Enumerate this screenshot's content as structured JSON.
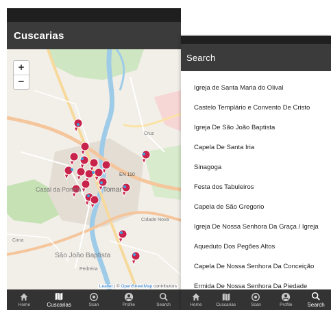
{
  "map_screen": {
    "title": "Cuscarias",
    "zoom_in": "+",
    "zoom_out": "−",
    "place_labels": [
      "Tomar",
      "São João Baptista",
      "Pedreira",
      "EN 110",
      "Cima",
      "Cruz",
      "Casal da Portela",
      "Cidade Nova"
    ],
    "attribution": {
      "leaflet": "Leaflet",
      "separator": " | © ",
      "osm": "OpenStreetMap",
      "contributors": " contributors"
    }
  },
  "search_screen": {
    "title": "Search",
    "results": [
      "Igreja de Santa Maria do Olival",
      "Castelo Templário e Convento De Cristo",
      "Igreja De São João Baptista",
      "Capela De Santa Iria",
      "Sinagoga",
      "Festa dos Tabuleiros",
      "Capela de São Gregorio",
      "Igreja De Nossa Senhora Da Graça / Igreja",
      "Aqueduto Dos Pegões Altos",
      "Capela De Nossa Senhora Da Conceição",
      "Ermida De Nossa Senhora Da Piedade"
    ]
  },
  "nav": {
    "map_screen": [
      {
        "label": "Home",
        "icon": "home-icon"
      },
      {
        "label": "Cuscarias",
        "icon": "map-icon",
        "active": true
      },
      {
        "label": "Scan",
        "icon": "scan-icon"
      },
      {
        "label": "Profile",
        "icon": "profile-icon"
      },
      {
        "label": "Search",
        "icon": "search-icon"
      }
    ],
    "search_screen": [
      {
        "label": "Home",
        "icon": "home-icon"
      },
      {
        "label": "Cuscarias",
        "icon": "map-icon"
      },
      {
        "label": "Scan",
        "icon": "scan-icon"
      },
      {
        "label": "Profile",
        "icon": "profile-icon"
      },
      {
        "label": "Search",
        "icon": "search-icon",
        "active": true
      }
    ]
  },
  "colors": {
    "appbar": "#3b3b3b",
    "statusbar": "#1f1f1f",
    "bottomnav": "#333333",
    "marker": "#c8234a",
    "river": "#9ecbe8",
    "road_major": "#f5c59b"
  }
}
